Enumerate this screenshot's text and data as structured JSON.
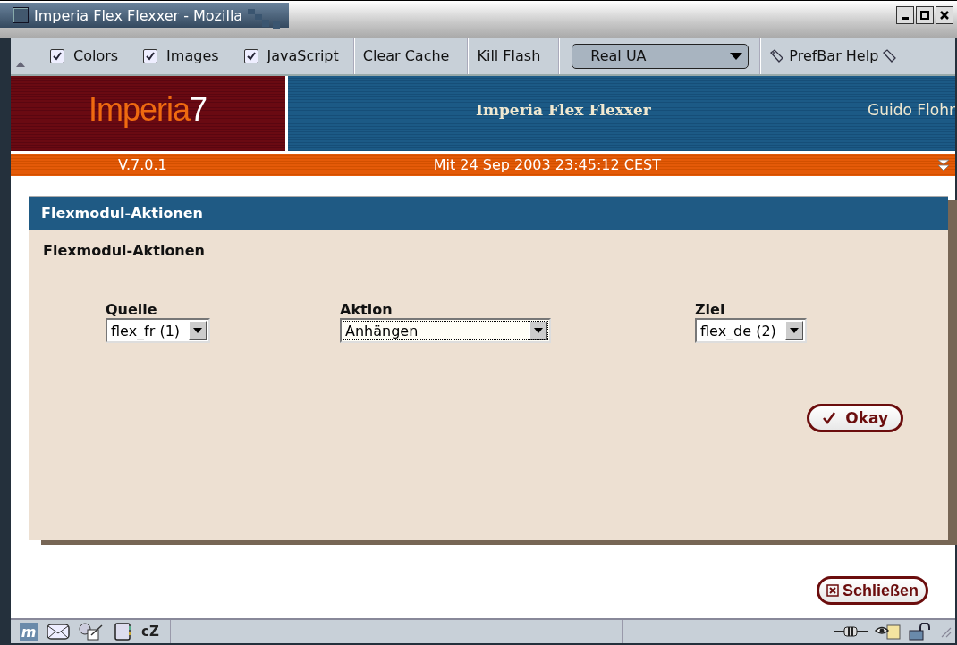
{
  "window": {
    "title": "Imperia Flex Flexxer - Mozilla"
  },
  "prefbar": {
    "checkboxes": [
      {
        "label": "Colors",
        "checked": true
      },
      {
        "label": "Images",
        "checked": true
      },
      {
        "label": "JavaScript",
        "checked": true
      }
    ],
    "buttons": [
      "Clear Cache",
      "Kill Flash"
    ],
    "ua_dropdown": {
      "value": "Real UA"
    },
    "help": "PrefBar Help"
  },
  "header": {
    "logo_word": "Imperia",
    "logo_number": "7",
    "app_title": "Imperia Flex Flexxer",
    "user": "Guido Flohr",
    "version": "V.7.0.1",
    "datetime": "Mit 24 Sep 2003 23:45:12 CEST"
  },
  "panel": {
    "title": "Flexmodul-Aktionen",
    "heading": "Flexmodul-Aktionen",
    "fields": [
      {
        "label": "Quelle",
        "value": "flex_fr (1)",
        "focused": false
      },
      {
        "label": "Aktion",
        "value": "Anhängen",
        "focused": true
      },
      {
        "label": "Ziel",
        "value": "flex_de (2)",
        "focused": false
      }
    ],
    "okay": "Okay"
  },
  "close_button": "Schließen",
  "status_bar": {
    "component_icons": [
      "m",
      "cZ"
    ]
  }
}
